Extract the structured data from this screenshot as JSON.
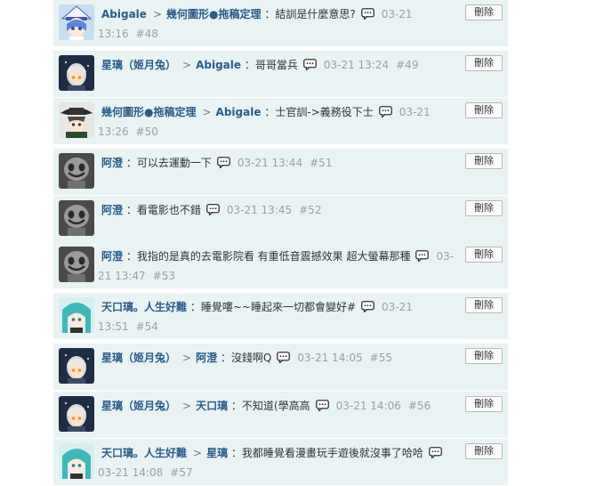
{
  "delete_label": "刪除",
  "colors": {
    "username": "#2a5c8a",
    "row_background": "#e9f3f3",
    "muted": "#9aa0a0"
  },
  "comments": [
    {
      "avatar": "white-hat-anime-avatar",
      "author": "Abigale",
      "reply_to": "幾何圖形●拖稿定理",
      "text": "：結訓是什麼意思?",
      "date_line1": "03-21",
      "date_line2": "13:16",
      "num": "#48"
    },
    {
      "avatar": "silver-hair-anime-avatar",
      "author": "星璃（姬月兔）",
      "reply_to": "Abigale",
      "text": "：哥哥當兵",
      "date_line1": "03-21 13:24",
      "num": "#49"
    },
    {
      "avatar": "dark-hat-anime-avatar",
      "author": "幾何圖形●拖稿定理",
      "reply_to": "Abigale",
      "text": "：士官訓->義務役下士",
      "date_line1": "03-21",
      "date_line2": "13:26",
      "num": "#50"
    },
    {
      "avatar": "gray-smiley-avatar",
      "author": "阿澄",
      "text": "：可以去運動一下",
      "date_line1": "03-21 13:44",
      "num": "#51"
    },
    {
      "avatar": "gray-smiley-avatar",
      "author": "阿澄",
      "text": "：看電影也不錯",
      "date_line1": "03-21 13:45",
      "num": "#52"
    },
    {
      "avatar": "gray-smiley-avatar",
      "author": "阿澄",
      "text": "：我指的是真的去電影院看 有重低音震撼效果 超大螢幕那種",
      "date_line1": "03-",
      "date_line2": "21 13:47",
      "num": "#53"
    },
    {
      "avatar": "teal-hair-anime-avatar",
      "author": "天口璃。人生好難",
      "text": "：睡覺嘍~~睡起來一切都會變好#",
      "date_line1": "03-21",
      "date_line2": "13:51",
      "num": "#54"
    },
    {
      "avatar": "silver-hair-anime-avatar",
      "author": "星璃（姬月兔）",
      "reply_to": "阿澄",
      "text": "：沒錢啊Q",
      "date_line1": "03-21 14:05",
      "num": "#55"
    },
    {
      "avatar": "silver-hair-anime-avatar",
      "author": "星璃（姬月兔）",
      "reply_to": "天口璃",
      "text": "：不知道(學高高",
      "date_line1": "03-21 14:06",
      "num": "#56"
    },
    {
      "avatar": "teal-hair-anime-avatar",
      "author": "天口璃。人生好難",
      "reply_to": "星璃",
      "text": "：我都睡覺看漫畫玩手遊後就沒事了哈哈",
      "date_line2": "03-21 14:08",
      "num": "#57"
    }
  ]
}
